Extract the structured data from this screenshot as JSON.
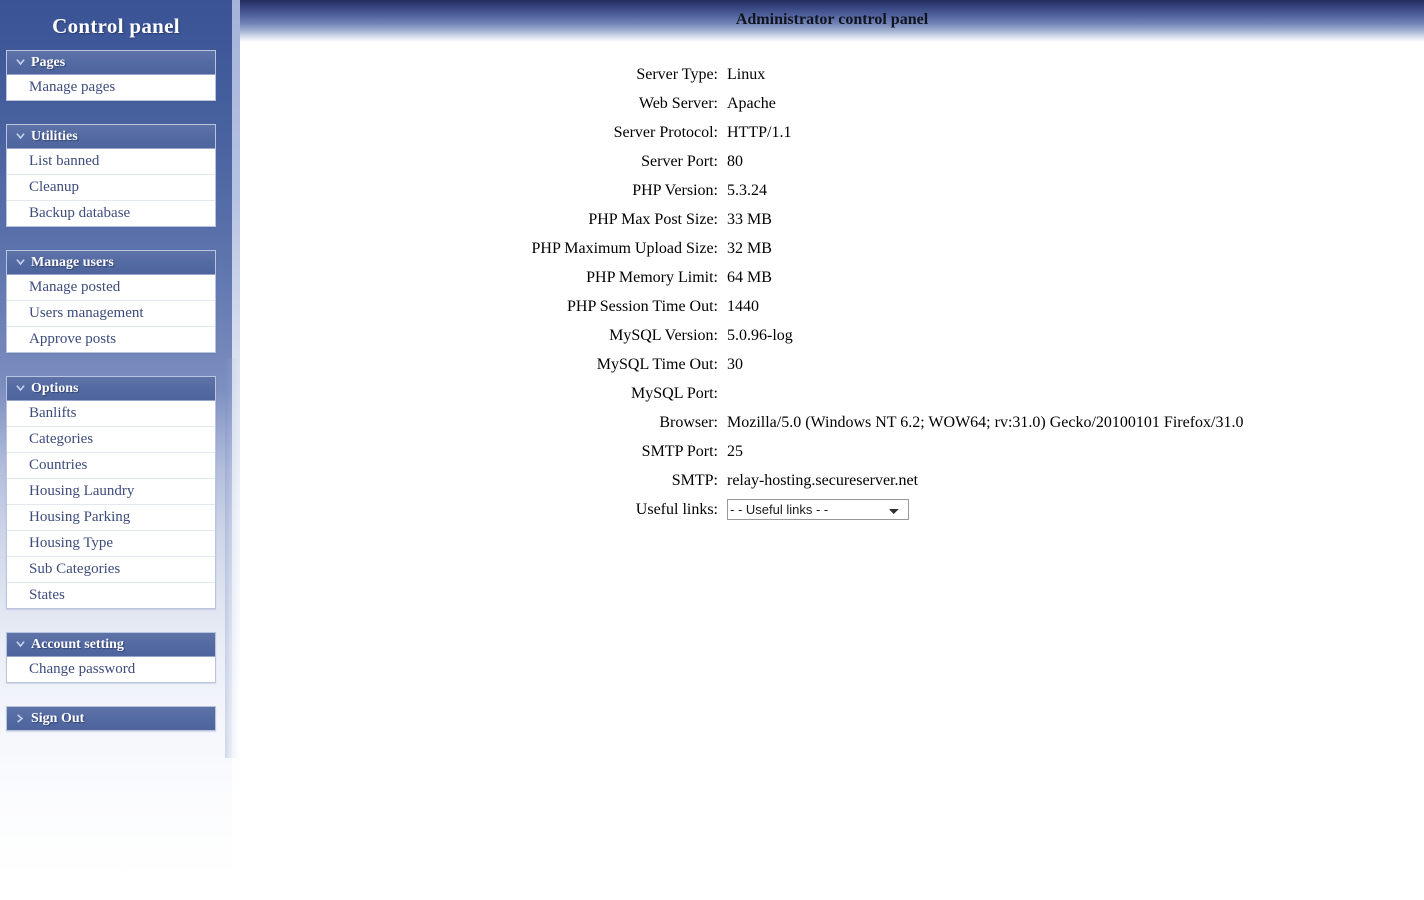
{
  "colors": {
    "sidebar_top": "#3a5395",
    "group_header": "#536aa2",
    "item_text": "#3d4c7c",
    "header_gradient_top": "#262d5e",
    "main_title_text": "#101420"
  },
  "sidebar": {
    "title": "Control panel",
    "groups": [
      {
        "label": "Pages",
        "icon": "chevron-down-icon",
        "items": [
          "Manage pages"
        ]
      },
      {
        "label": "Utilities",
        "icon": "chevron-down-icon",
        "items": [
          "List banned",
          "Cleanup",
          "Backup database"
        ]
      },
      {
        "label": "Manage users",
        "icon": "chevron-down-icon",
        "items": [
          "Manage posted",
          "Users management",
          "Approve posts"
        ]
      },
      {
        "label": "Options",
        "icon": "chevron-down-icon",
        "items": [
          "Banlifts",
          "Categories",
          "Countries",
          "Housing Laundry",
          "Housing Parking",
          "Housing Type",
          "Sub Categories",
          "States"
        ]
      },
      {
        "label": "Account setting",
        "icon": "chevron-down-icon",
        "items": [
          "Change password"
        ]
      }
    ],
    "signout": {
      "label": "Sign Out",
      "icon": "chevron-right-icon"
    }
  },
  "main": {
    "header_title": "Administrator control panel",
    "rows": [
      {
        "label": "Server Type:",
        "value": "Linux"
      },
      {
        "label": "Web Server:",
        "value": "Apache"
      },
      {
        "label": "Server Protocol:",
        "value": "HTTP/1.1"
      },
      {
        "label": "Server Port:",
        "value": "80"
      },
      {
        "label": "PHP Version:",
        "value": "5.3.24"
      },
      {
        "label": "PHP Max Post Size:",
        "value": "33 MB"
      },
      {
        "label": "PHP Maximum Upload Size:",
        "value": "32 MB"
      },
      {
        "label": "PHP Memory Limit:",
        "value": "64 MB"
      },
      {
        "label": "PHP Session Time Out:",
        "value": "1440"
      },
      {
        "label": "MySQL Version:",
        "value": "5.0.96-log"
      },
      {
        "label": "MySQL Time Out:",
        "value": "30"
      },
      {
        "label": "MySQL Port:",
        "value": ""
      },
      {
        "label": "Browser:",
        "value": "Mozilla/5.0 (Windows NT 6.2; WOW64; rv:31.0) Gecko/20100101 Firefox/31.0"
      },
      {
        "label": "SMTP Port:",
        "value": "25"
      },
      {
        "label": "SMTP:",
        "value": "relay-hosting.secureserver.net"
      }
    ],
    "useful_links": {
      "label": "Useful links:",
      "selected": "- - Useful links - -",
      "options": [
        "- - Useful links - -"
      ]
    }
  }
}
